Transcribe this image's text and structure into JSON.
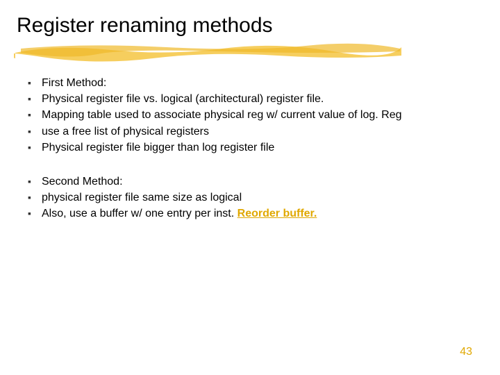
{
  "title": "Register renaming methods",
  "group1": {
    "b0": "First Method:",
    "b1": "Physical register file vs. logical (architectural) register file.",
    "b2": "Mapping table used to associate physical reg w/ current value of log. Reg",
    "b3": "use a free list of physical registers",
    "b4": "Physical register file bigger than log register file"
  },
  "group2": {
    "b0": "Second Method:",
    "b1": "physical register file same size as logical",
    "b2_prefix": "Also, use a buffer w/ one entry per inst.  ",
    "b2_link": "Reorder buffer."
  },
  "page_number": "43"
}
